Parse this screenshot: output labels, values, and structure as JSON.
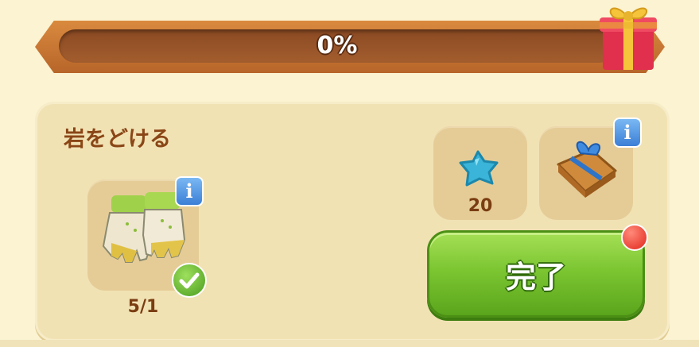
{
  "progress": {
    "label": "0%",
    "value": 0
  },
  "task": {
    "title": "岩をどける",
    "required_item": {
      "icon": "gloves-icon",
      "count": "5/1",
      "completed": true
    },
    "rewards": [
      {
        "icon": "blue-star-icon",
        "amount": "20"
      },
      {
        "icon": "wrapped-gift-icon"
      }
    ],
    "complete_button": {
      "label": "完了"
    }
  },
  "colors": {
    "accent_green": "#7cc632",
    "title_brown": "#8a4616",
    "info_blue": "#3b7fd6",
    "notification_red": "#e1261b"
  }
}
